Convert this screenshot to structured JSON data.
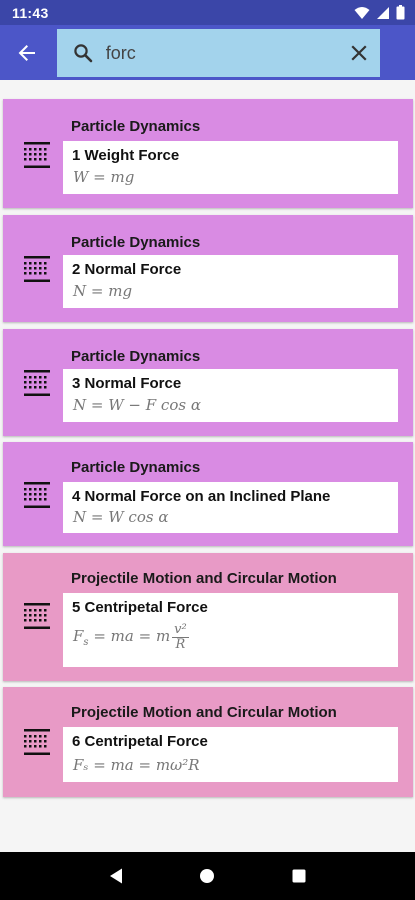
{
  "status_bar": {
    "time": "11:43"
  },
  "search": {
    "query": "forc",
    "placeholder": ""
  },
  "colors": {
    "status_bar": "#3b46a8",
    "app_bar": "#4c56c8",
    "search_box": "#a3d3ec",
    "card_purple": "#d98be3",
    "card_pink": "#e89ac6"
  },
  "results": [
    {
      "category": "Particle Dynamics",
      "title": "1 Weight Force",
      "formula": "W = mg"
    },
    {
      "category": "Particle Dynamics",
      "title": "2 Normal Force",
      "formula": "N = mg"
    },
    {
      "category": "Particle Dynamics",
      "title": "3 Normal Force",
      "formula": "N = W − F cos α"
    },
    {
      "category": "Particle Dynamics",
      "title": "4 Normal Force on an Inclined Plane",
      "formula": "N = W cos α"
    },
    {
      "category": "Projectile Motion and Circular Motion",
      "title": "5 Centripetal Force",
      "formula_lhs": "F",
      "formula_sub": "s",
      "formula_mid": " = ma = m",
      "formula_num": "v²",
      "formula_den": "R"
    },
    {
      "category": "Projectile Motion and Circular Motion",
      "title": "6 Centripetal Force",
      "formula": "Fₛ = ma = mω²R"
    }
  ],
  "icons": {
    "back": "arrow-back-icon",
    "search": "search-icon",
    "clear": "close-icon",
    "list": "formula-list-icon",
    "nav_back": "triangle-back-icon",
    "nav_home": "circle-home-icon",
    "nav_recent": "square-recents-icon"
  }
}
